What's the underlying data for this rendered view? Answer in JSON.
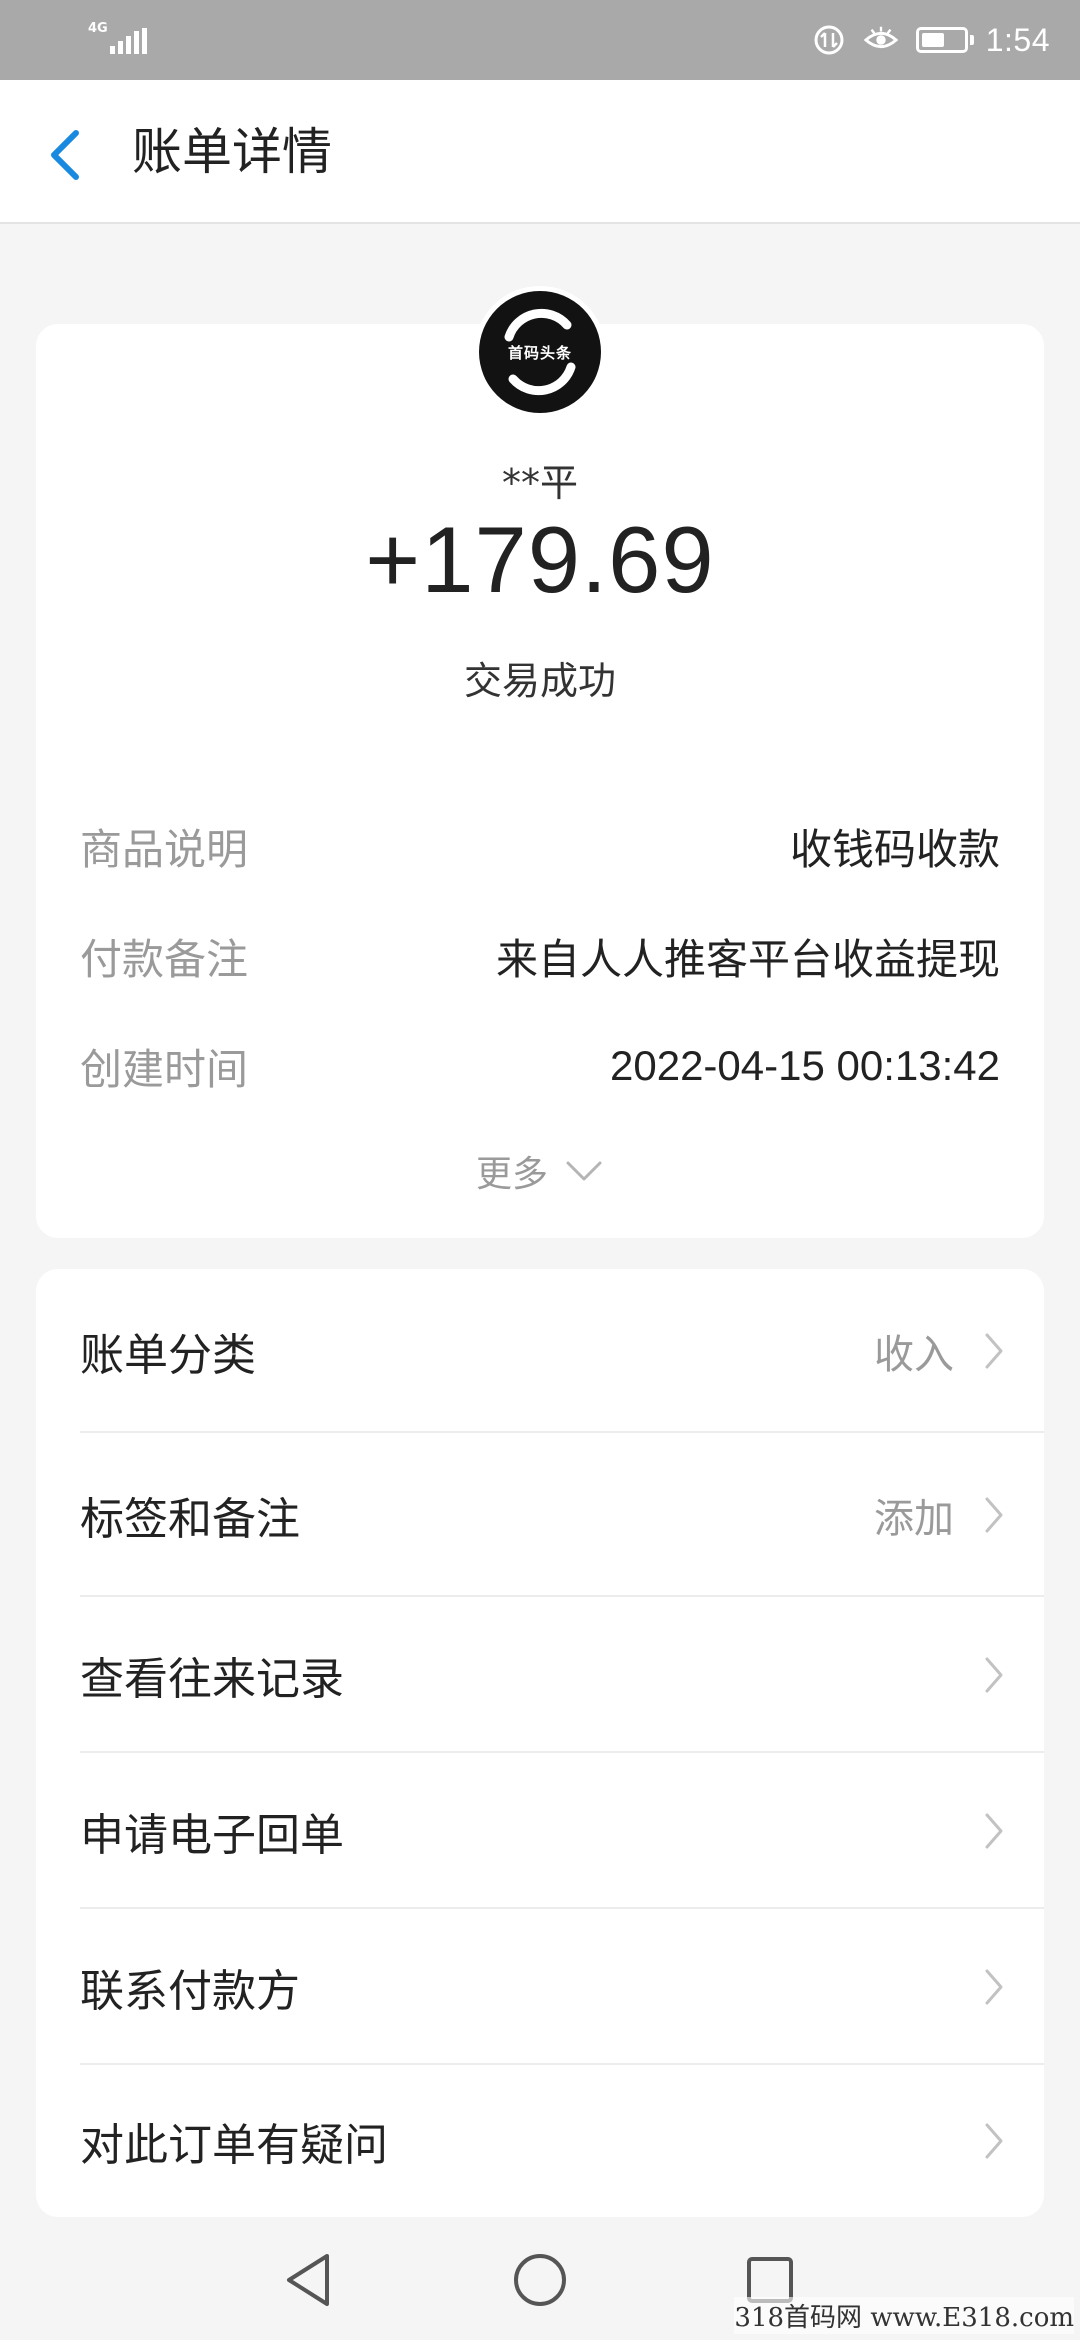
{
  "status_bar": {
    "network": "4G",
    "time": "1:54",
    "battery_level": 0.55
  },
  "header": {
    "title": "账单详情"
  },
  "summary": {
    "avatar_text": "首码头条",
    "payer": "**平",
    "amount": "+179.69",
    "status": "交易成功",
    "details": [
      {
        "label": "商品说明",
        "value": "收钱码收款"
      },
      {
        "label": "付款备注",
        "value": "来自人人推客平台收益提现"
      },
      {
        "label": "创建时间",
        "value": "2022-04-15 00:13:42"
      }
    ],
    "more_label": "更多"
  },
  "actions": [
    {
      "label": "账单分类",
      "value": "收入"
    },
    {
      "label": "标签和备注",
      "value": "添加"
    },
    {
      "label": "查看往来记录",
      "value": ""
    },
    {
      "label": "申请电子回单",
      "value": ""
    },
    {
      "label": "联系付款方",
      "value": ""
    },
    {
      "label": "对此订单有疑问",
      "value": ""
    }
  ],
  "watermark": "318首码网 www.E318.com"
}
